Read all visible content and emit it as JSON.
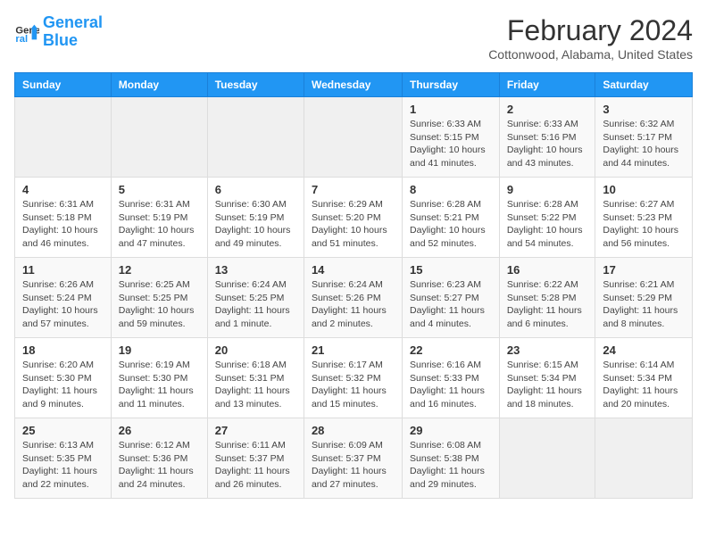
{
  "logo": {
    "line1": "General",
    "line2": "Blue"
  },
  "title": "February 2024",
  "location": "Cottonwood, Alabama, United States",
  "weekdays": [
    "Sunday",
    "Monday",
    "Tuesday",
    "Wednesday",
    "Thursday",
    "Friday",
    "Saturday"
  ],
  "weeks": [
    [
      {
        "day": "",
        "sunrise": "",
        "sunset": "",
        "daylight": ""
      },
      {
        "day": "",
        "sunrise": "",
        "sunset": "",
        "daylight": ""
      },
      {
        "day": "",
        "sunrise": "",
        "sunset": "",
        "daylight": ""
      },
      {
        "day": "",
        "sunrise": "",
        "sunset": "",
        "daylight": ""
      },
      {
        "day": "1",
        "sunrise": "6:33 AM",
        "sunset": "5:15 PM",
        "daylight": "10 hours and 41 minutes."
      },
      {
        "day": "2",
        "sunrise": "6:33 AM",
        "sunset": "5:16 PM",
        "daylight": "10 hours and 43 minutes."
      },
      {
        "day": "3",
        "sunrise": "6:32 AM",
        "sunset": "5:17 PM",
        "daylight": "10 hours and 44 minutes."
      }
    ],
    [
      {
        "day": "4",
        "sunrise": "6:31 AM",
        "sunset": "5:18 PM",
        "daylight": "10 hours and 46 minutes."
      },
      {
        "day": "5",
        "sunrise": "6:31 AM",
        "sunset": "5:19 PM",
        "daylight": "10 hours and 47 minutes."
      },
      {
        "day": "6",
        "sunrise": "6:30 AM",
        "sunset": "5:19 PM",
        "daylight": "10 hours and 49 minutes."
      },
      {
        "day": "7",
        "sunrise": "6:29 AM",
        "sunset": "5:20 PM",
        "daylight": "10 hours and 51 minutes."
      },
      {
        "day": "8",
        "sunrise": "6:28 AM",
        "sunset": "5:21 PM",
        "daylight": "10 hours and 52 minutes."
      },
      {
        "day": "9",
        "sunrise": "6:28 AM",
        "sunset": "5:22 PM",
        "daylight": "10 hours and 54 minutes."
      },
      {
        "day": "10",
        "sunrise": "6:27 AM",
        "sunset": "5:23 PM",
        "daylight": "10 hours and 56 minutes."
      }
    ],
    [
      {
        "day": "11",
        "sunrise": "6:26 AM",
        "sunset": "5:24 PM",
        "daylight": "10 hours and 57 minutes."
      },
      {
        "day": "12",
        "sunrise": "6:25 AM",
        "sunset": "5:25 PM",
        "daylight": "10 hours and 59 minutes."
      },
      {
        "day": "13",
        "sunrise": "6:24 AM",
        "sunset": "5:25 PM",
        "daylight": "11 hours and 1 minute."
      },
      {
        "day": "14",
        "sunrise": "6:24 AM",
        "sunset": "5:26 PM",
        "daylight": "11 hours and 2 minutes."
      },
      {
        "day": "15",
        "sunrise": "6:23 AM",
        "sunset": "5:27 PM",
        "daylight": "11 hours and 4 minutes."
      },
      {
        "day": "16",
        "sunrise": "6:22 AM",
        "sunset": "5:28 PM",
        "daylight": "11 hours and 6 minutes."
      },
      {
        "day": "17",
        "sunrise": "6:21 AM",
        "sunset": "5:29 PM",
        "daylight": "11 hours and 8 minutes."
      }
    ],
    [
      {
        "day": "18",
        "sunrise": "6:20 AM",
        "sunset": "5:30 PM",
        "daylight": "11 hours and 9 minutes."
      },
      {
        "day": "19",
        "sunrise": "6:19 AM",
        "sunset": "5:30 PM",
        "daylight": "11 hours and 11 minutes."
      },
      {
        "day": "20",
        "sunrise": "6:18 AM",
        "sunset": "5:31 PM",
        "daylight": "11 hours and 13 minutes."
      },
      {
        "day": "21",
        "sunrise": "6:17 AM",
        "sunset": "5:32 PM",
        "daylight": "11 hours and 15 minutes."
      },
      {
        "day": "22",
        "sunrise": "6:16 AM",
        "sunset": "5:33 PM",
        "daylight": "11 hours and 16 minutes."
      },
      {
        "day": "23",
        "sunrise": "6:15 AM",
        "sunset": "5:34 PM",
        "daylight": "11 hours and 18 minutes."
      },
      {
        "day": "24",
        "sunrise": "6:14 AM",
        "sunset": "5:34 PM",
        "daylight": "11 hours and 20 minutes."
      }
    ],
    [
      {
        "day": "25",
        "sunrise": "6:13 AM",
        "sunset": "5:35 PM",
        "daylight": "11 hours and 22 minutes."
      },
      {
        "day": "26",
        "sunrise": "6:12 AM",
        "sunset": "5:36 PM",
        "daylight": "11 hours and 24 minutes."
      },
      {
        "day": "27",
        "sunrise": "6:11 AM",
        "sunset": "5:37 PM",
        "daylight": "11 hours and 26 minutes."
      },
      {
        "day": "28",
        "sunrise": "6:09 AM",
        "sunset": "5:37 PM",
        "daylight": "11 hours and 27 minutes."
      },
      {
        "day": "29",
        "sunrise": "6:08 AM",
        "sunset": "5:38 PM",
        "daylight": "11 hours and 29 minutes."
      },
      {
        "day": "",
        "sunrise": "",
        "sunset": "",
        "daylight": ""
      },
      {
        "day": "",
        "sunrise": "",
        "sunset": "",
        "daylight": ""
      }
    ]
  ]
}
